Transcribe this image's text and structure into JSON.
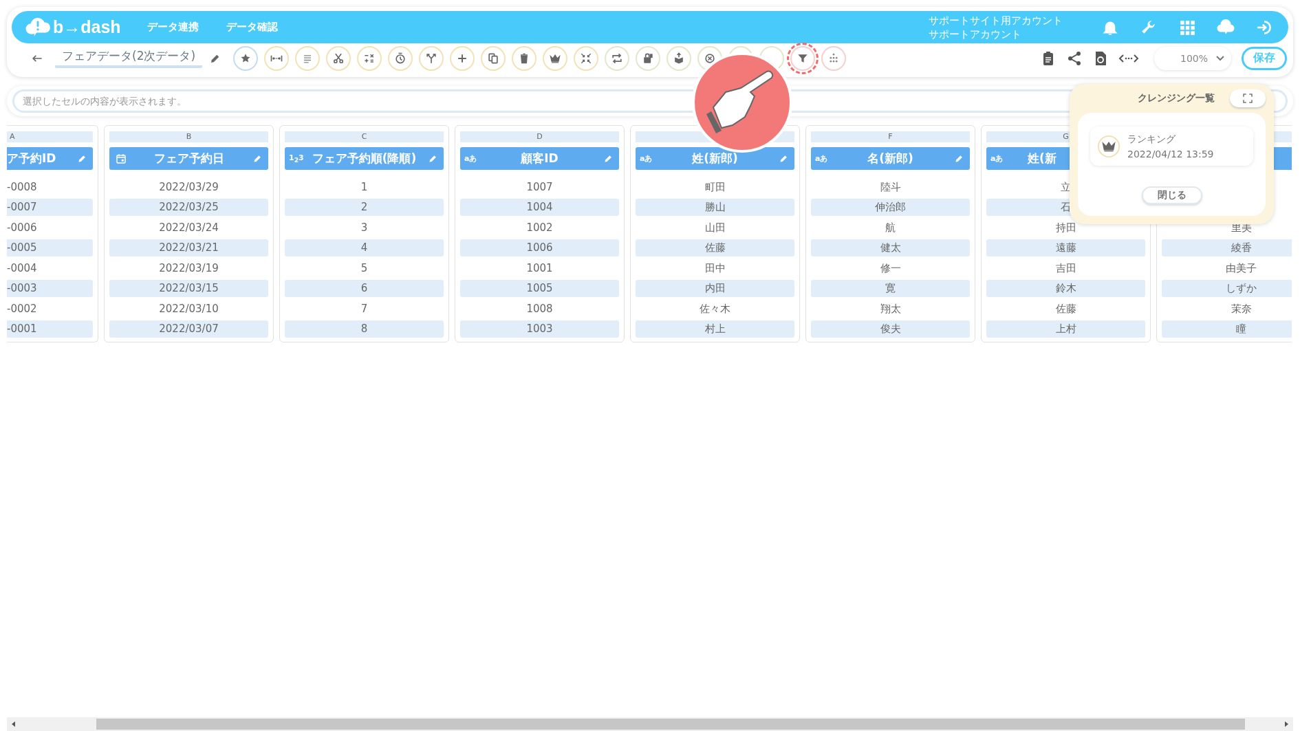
{
  "header": {
    "logo": "b→dash",
    "nav": [
      {
        "label": "データ連携"
      },
      {
        "label": "データ確認"
      }
    ],
    "account": [
      "サポートサイト用アカウント",
      "サポートアカウント"
    ]
  },
  "toolbar": {
    "title": "フェアデータ(2次データ)",
    "zoom": "100%",
    "save": "保存",
    "tools": [
      {
        "kind": "star",
        "color": "#c6dbef",
        "highlighted": false
      },
      {
        "kind": "connect",
        "color": "#f3e2b5",
        "highlighted": false
      },
      {
        "kind": "lines",
        "color": "#f3e2b5",
        "highlighted": false
      },
      {
        "kind": "scissors",
        "color": "#f3e2b5",
        "highlighted": false
      },
      {
        "kind": "calc",
        "color": "#f3e2b5",
        "highlighted": false
      },
      {
        "kind": "timer",
        "color": "#f3e2b5",
        "highlighted": false
      },
      {
        "kind": "split",
        "color": "#f3e2b5",
        "highlighted": false
      },
      {
        "kind": "plus",
        "color": "#f3e2b5",
        "highlighted": false
      },
      {
        "kind": "copy",
        "color": "#f3e2b5",
        "highlighted": false
      },
      {
        "kind": "trash",
        "color": "#f3e2b5",
        "highlighted": false
      },
      {
        "kind": "crown",
        "color": "#f3e2b5",
        "highlighted": false
      },
      {
        "kind": "compress",
        "color": "#f3e2b5",
        "highlighted": false
      },
      {
        "kind": "swap",
        "color": "#e2e8cc",
        "highlighted": false
      },
      {
        "kind": "lock",
        "color": "#e2e8cc",
        "highlighted": false
      },
      {
        "kind": "upload",
        "color": "#e2e8cc",
        "highlighted": false
      },
      {
        "kind": "cancel",
        "color": "#e2e8cc",
        "highlighted": false
      },
      {
        "kind": "covered",
        "color": "#e2e8cc",
        "highlighted": false
      },
      {
        "kind": "covered",
        "color": "#e2e8cc",
        "highlighted": false
      },
      {
        "kind": "filter",
        "color": "#f7cfcf",
        "highlighted": true
      },
      {
        "kind": "people",
        "color": "#f7cfcf",
        "highlighted": false
      }
    ]
  },
  "formula_bar": {
    "placeholder": "選択したセルの内容が表示されます。"
  },
  "columns": [
    {
      "letter": "A",
      "name": "ア予約ID",
      "cells": [
        "-0008",
        "-0007",
        "-0006",
        "-0005",
        "-0004",
        "-0003",
        "-0002",
        "-0001"
      ]
    },
    {
      "letter": "B",
      "kind": "date",
      "name": "フェア予約日",
      "cells": [
        "2022/03/29",
        "2022/03/25",
        "2022/03/24",
        "2022/03/21",
        "2022/03/19",
        "2022/03/15",
        "2022/03/10",
        "2022/03/07"
      ]
    },
    {
      "letter": "C",
      "kind": "number",
      "type_label": "1$_{2}$3",
      "name": "フェア予約順(降順)",
      "cells": [
        "1",
        "2",
        "3",
        "4",
        "5",
        "6",
        "7",
        "8"
      ]
    },
    {
      "letter": "D",
      "kind": "text",
      "type_label": "aあ",
      "name": "顧客ID",
      "cells": [
        "1007",
        "1004",
        "1002",
        "1006",
        "1001",
        "1005",
        "1008",
        "1003"
      ]
    },
    {
      "kind": "text",
      "type_label": "aあ",
      "name": "姓(新郎)",
      "cells": [
        "町田",
        "勝山",
        "山田",
        "佐藤",
        "田中",
        "内田",
        "佐々木",
        "村上"
      ]
    },
    {
      "letter": "F",
      "kind": "text",
      "type_label": "aあ",
      "name": "名(新郎)",
      "cells": [
        "陸斗",
        "伸治郎",
        "航",
        "健太",
        "修一",
        "寛",
        "翔太",
        "俊夫"
      ]
    },
    {
      "letter": "G",
      "kind": "text",
      "type_label": "aあ",
      "name": "姓(新",
      "cells": [
        "立",
        "石",
        "持田",
        "遠藤",
        "吉田",
        "鈴木",
        "佐藤",
        "上村"
      ]
    },
    {
      "cells": [
        "里美",
        "綾香",
        "由美子",
        "しずか",
        "茉奈",
        "瞳"
      ]
    }
  ],
  "popup": {
    "title": "クレンジング一覧",
    "items": [
      {
        "name": "ランキング",
        "time": "2022/04/12 13:59"
      }
    ],
    "close": "閉じる"
  }
}
